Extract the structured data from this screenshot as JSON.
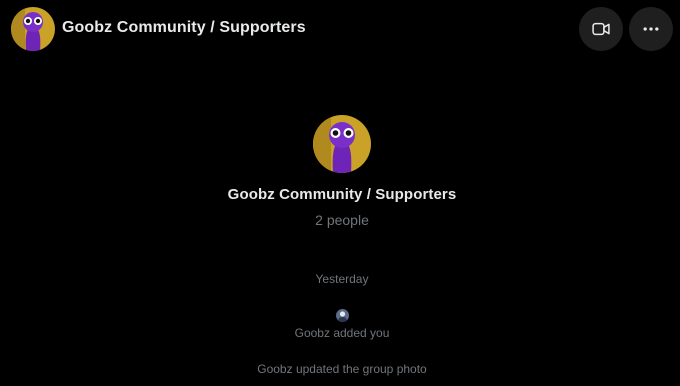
{
  "header": {
    "title": "Goobz Community / Supporters",
    "avatar_icon": "purple-alien-avatar",
    "video_icon": "video-camera-icon",
    "more_icon": "more-horizontal-icon"
  },
  "group": {
    "name": "Goobz Community / Supporters",
    "member_count": "2 people"
  },
  "conversation": {
    "timestamp": "Yesterday",
    "events": [
      {
        "text": "Goobz added you",
        "has_avatar": true
      },
      {
        "text": "Goobz updated the group photo",
        "has_avatar": false
      }
    ]
  },
  "colors": {
    "background": "#000000",
    "primary_text": "#e7e9ea",
    "secondary_text": "#71767b",
    "button_bg": "#1f1f1f",
    "avatar_bg": "#c9a227",
    "avatar_figure": "#7b2fc9"
  }
}
